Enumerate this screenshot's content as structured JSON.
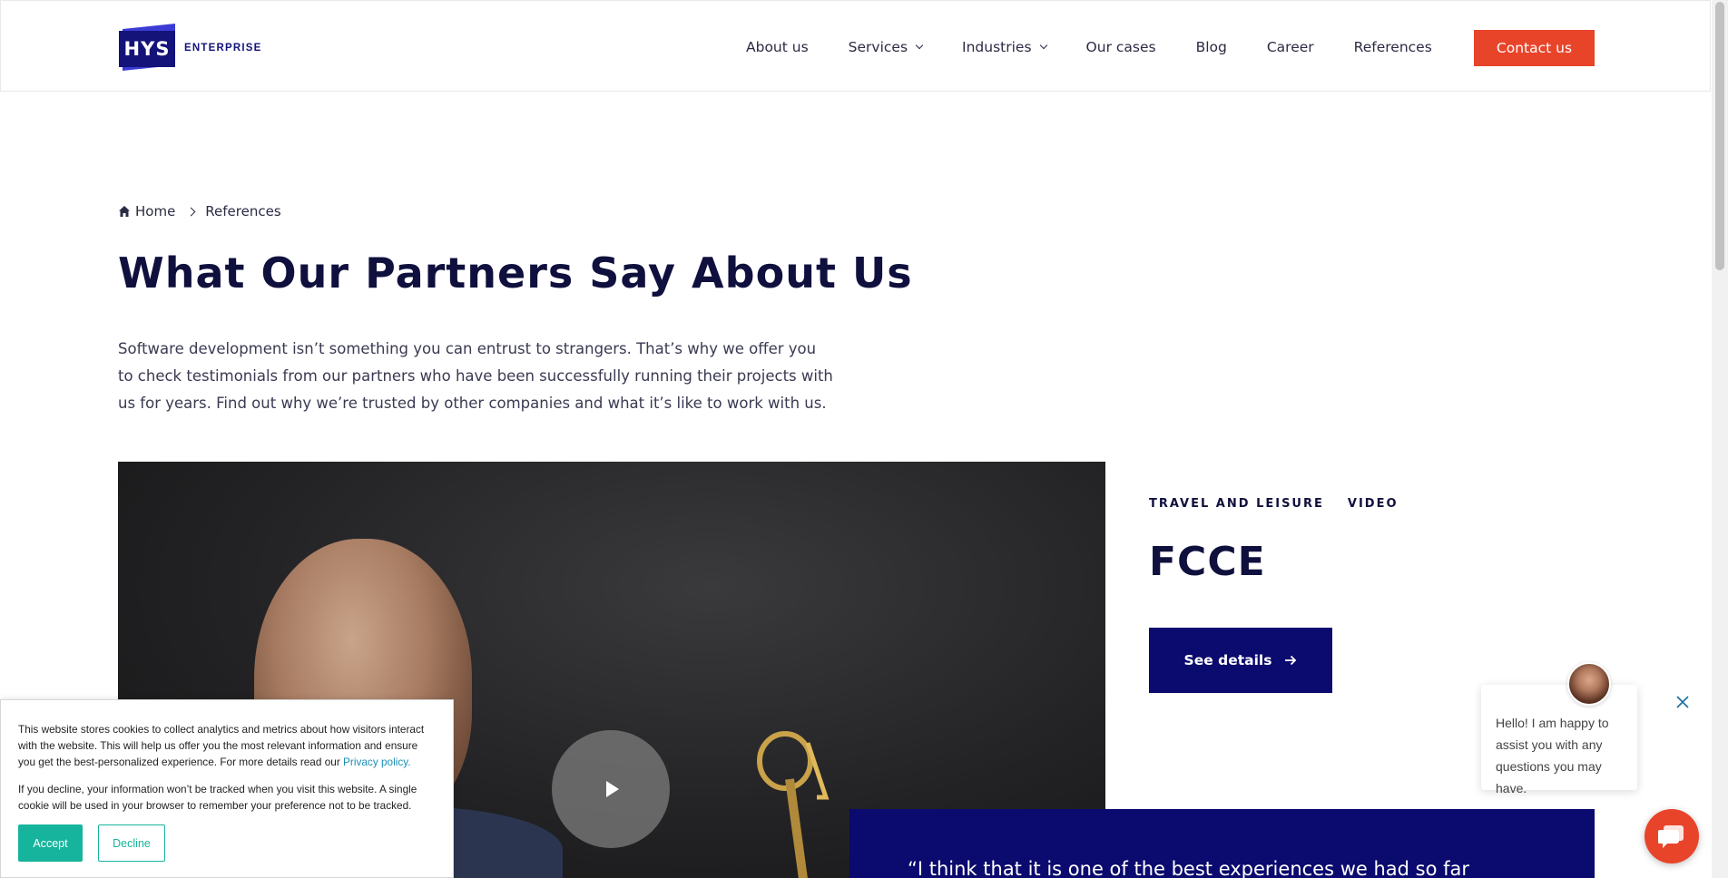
{
  "header": {
    "logo_mark": "HYS",
    "logo_text": "ENTERPRISE",
    "nav": [
      {
        "label": "About us",
        "has_dropdown": false
      },
      {
        "label": "Services",
        "has_dropdown": true
      },
      {
        "label": "Industries",
        "has_dropdown": true
      },
      {
        "label": "Our cases",
        "has_dropdown": false
      },
      {
        "label": "Blog",
        "has_dropdown": false
      },
      {
        "label": "Career",
        "has_dropdown": false
      },
      {
        "label": "References",
        "has_dropdown": false
      }
    ],
    "contact_label": "Contact us"
  },
  "breadcrumb": {
    "home": "Home",
    "current": "References"
  },
  "page": {
    "title": "What Our Partners Say About Us",
    "intro": "Software development isn’t something you can entrust to strangers. That’s why we offer you to check testimonials from our partners who have been successfully running their projects with us for years. Find out why we’re trusted by other companies and what it’s like to work with us."
  },
  "case": {
    "tags": [
      "TRAVEL AND LEISURE",
      "VIDEO"
    ],
    "title": "FCCE",
    "details_label": "See details",
    "quote": "“I think that it is one of the best experiences we had so far"
  },
  "cookie": {
    "text1": "This website stores cookies to collect analytics and metrics about how visitors interact with the website. This will help us offer you the most relevant information and ensure you get the best-personalized experience. For more details read our",
    "policy_link": "Privacy policy.",
    "text2": "If you decline, your information won’t be tracked when you visit this website. A single cookie will be used in your browser to remember your preference not to be tracked.",
    "accept": "Accept",
    "decline": "Decline"
  },
  "chat": {
    "message": "Hello! I am happy to assist you with any questions you may have."
  },
  "colors": {
    "brand_navy": "#0b0a6e",
    "accent_orange": "#e8442a",
    "cookie_teal": "#16b49c"
  }
}
